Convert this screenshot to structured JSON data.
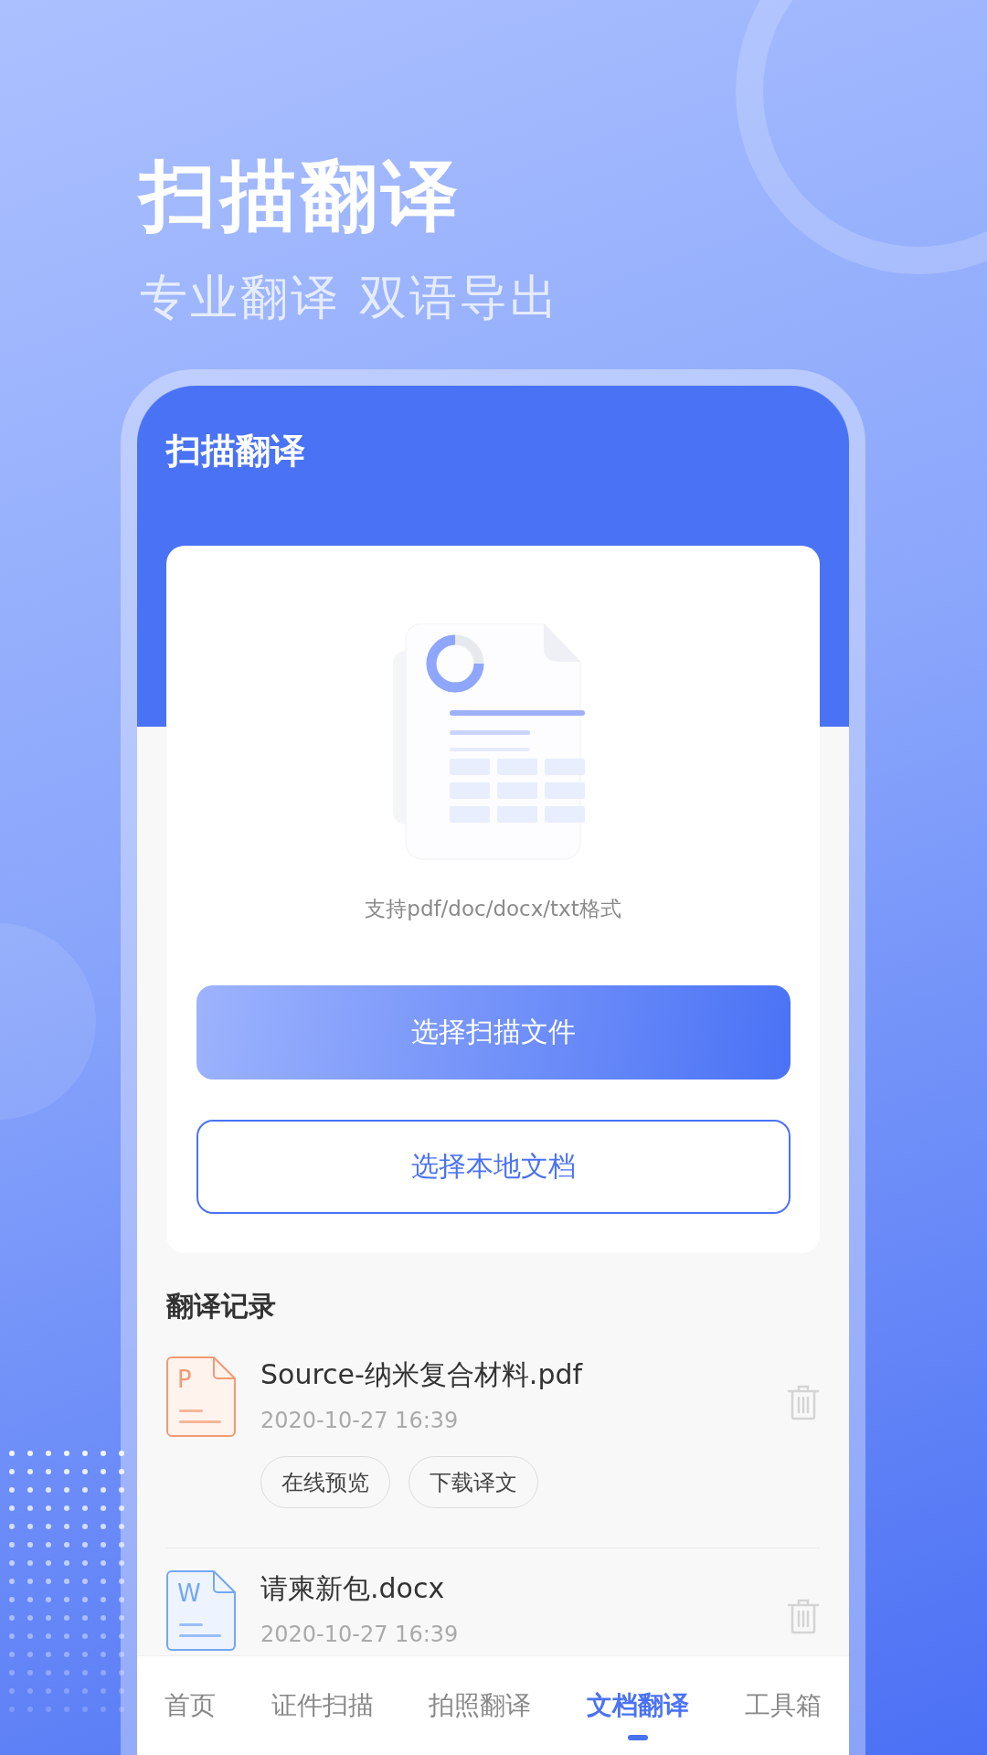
{
  "promo": {
    "title": "扫描翻译",
    "subtitle": "专业翻译 双语导出"
  },
  "app": {
    "title": "扫描翻译",
    "upload": {
      "caption": "支持pdf/doc/docx/txt格式",
      "buttons": [
        {
          "label": "选择扫描文件",
          "kind": "primary"
        },
        {
          "label": "选择本地文档",
          "kind": "outline"
        }
      ]
    },
    "history": {
      "title": "翻译记录",
      "items": [
        {
          "kind": "pdf",
          "letter": "P",
          "name": "Source-纳米复合材料.pdf",
          "time": "2020-10-27 16:39",
          "actions": [
            "在线预览",
            "下载译文"
          ]
        },
        {
          "kind": "docx",
          "letter": "W",
          "name": "请柬新包.docx",
          "time": "2020-10-27 16:39"
        }
      ]
    },
    "tabs": [
      {
        "label": "首页",
        "selected": false
      },
      {
        "label": "证件扫描",
        "selected": false
      },
      {
        "label": "拍照翻译",
        "selected": false
      },
      {
        "label": "文档翻译",
        "selected": true
      },
      {
        "label": "工具箱",
        "selected": false
      }
    ]
  }
}
